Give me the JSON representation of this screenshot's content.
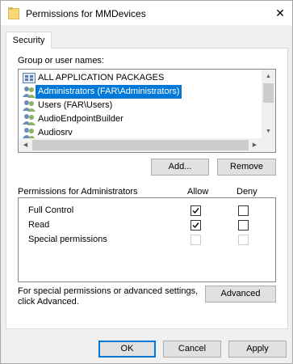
{
  "window": {
    "title": "Permissions for MMDevices",
    "close_glyph": "✕"
  },
  "tabs": [
    {
      "label": "Security"
    }
  ],
  "groups": {
    "label": "Group or user names:",
    "items": [
      {
        "label": "ALL APPLICATION PACKAGES",
        "icon": "packages-icon",
        "selected": false
      },
      {
        "label": "Administrators (FAR\\Administrators)",
        "icon": "user-group-icon",
        "selected": true
      },
      {
        "label": "Users (FAR\\Users)",
        "icon": "user-group-icon",
        "selected": false
      },
      {
        "label": "AudioEndpointBuilder",
        "icon": "user-group-icon",
        "selected": false
      },
      {
        "label": "Audiosrv",
        "icon": "user-group-icon",
        "selected": false
      }
    ],
    "add_label": "Add...",
    "remove_label": "Remove"
  },
  "permissions": {
    "header": "Permissions for Administrators",
    "allow_header": "Allow",
    "deny_header": "Deny",
    "rows": [
      {
        "label": "Full Control",
        "allow": true,
        "deny": false,
        "enabled": true
      },
      {
        "label": "Read",
        "allow": true,
        "deny": false,
        "enabled": true
      },
      {
        "label": "Special permissions",
        "allow": false,
        "deny": false,
        "enabled": false
      }
    ]
  },
  "advanced": {
    "text_line1": "For special permissions or advanced settings,",
    "text_line2": "click Advanced.",
    "button_label": "Advanced"
  },
  "footer": {
    "ok_label": "OK",
    "cancel_label": "Cancel",
    "apply_label": "Apply"
  },
  "colors": {
    "selection": "#0078d7",
    "folder": "#f8d775",
    "window_bg": "#f0f0f0"
  }
}
